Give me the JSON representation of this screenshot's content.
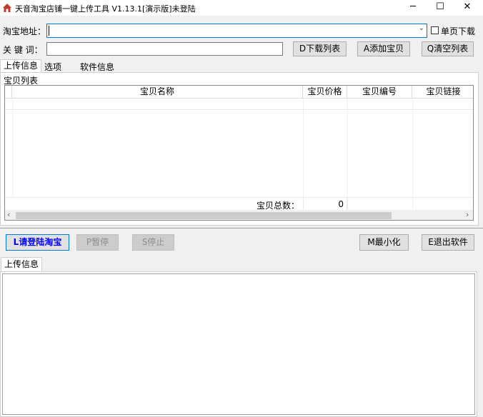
{
  "window": {
    "title": "天音淘宝店铺一键上传工具 V1.13.1[演示版]未登陆",
    "minimize": "─",
    "maximize": "☐",
    "close": "✕"
  },
  "form": {
    "url_label": "淘宝地址：",
    "url_value": "",
    "single_page_label": "单页下载",
    "keyword_label": "关 键 词：",
    "keyword_value": ""
  },
  "toolbar": {
    "download_list": "D下载列表",
    "add_item": "A添加宝贝",
    "clear_list": "Q清空列表"
  },
  "tabs": [
    "上传信息",
    "选项",
    "软件信息"
  ],
  "item_list": {
    "group_label": "宝贝列表",
    "columns": [
      "宝贝名称",
      "宝贝价格",
      "宝贝编号",
      "宝贝链接"
    ],
    "rows": [],
    "total_label": "宝贝总数：",
    "total_value": "0"
  },
  "actions": {
    "login": "L请登陆淘宝",
    "pause": "P暂停",
    "stop": "S停止",
    "minimize": "M最小化",
    "exit": "E退出软件"
  },
  "log": {
    "tab_label": "上传信息",
    "content": ""
  },
  "colors": {
    "login_text": "#0000ff",
    "title_icon": "#c0392b"
  }
}
